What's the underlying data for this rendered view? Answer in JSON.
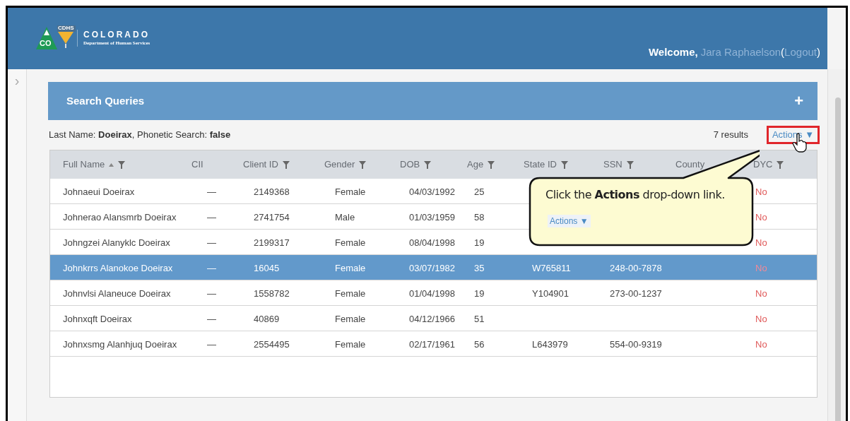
{
  "header": {
    "logo": {
      "state": "CO",
      "badge": "CDHS",
      "title": "COLORADO",
      "subtitle": "Department of Human Services"
    },
    "user_menu": {
      "greeting": "Welcome,",
      "user_name": "Jara Raphaelson",
      "open_paren": "(",
      "logout": "Logout",
      "close_paren": ")"
    }
  },
  "sidebar": {
    "toggle": "›"
  },
  "panel": {
    "title": "Search Queries",
    "add_button": "+"
  },
  "summary": "Last Name: **Doeirax**, Phonetic Search: **false**",
  "results_count": "7 results",
  "actions": {
    "label": "Actions",
    "caret": "▼"
  },
  "table": {
    "columns": [
      {
        "label": "Full Name",
        "sorted": true,
        "filter": true
      },
      {
        "label": "CII",
        "sorted": false,
        "filter": false
      },
      {
        "label": "Client ID",
        "sorted": false,
        "filter": true
      },
      {
        "label": "Gender",
        "sorted": false,
        "filter": true
      },
      {
        "label": "DOB",
        "sorted": false,
        "filter": true
      },
      {
        "label": "Age",
        "sorted": false,
        "filter": true
      },
      {
        "label": "State ID",
        "sorted": false,
        "filter": true
      },
      {
        "label": "SSN",
        "sorted": false,
        "filter": true
      },
      {
        "label": "County",
        "sorted": false,
        "filter": false
      },
      {
        "label": "DYC",
        "sorted": false,
        "filter": true
      }
    ],
    "rows": [
      {
        "selected": false,
        "cells": [
          "Johnaeui Doeirax",
          "—",
          "2149368",
          "Female",
          "04/03/1992",
          "25",
          null,
          null,
          null,
          "No"
        ]
      },
      {
        "selected": false,
        "cells": [
          "Johnerao Alansmrb Doeirax",
          "—",
          "2741754",
          "Male",
          "01/03/1959",
          "58",
          null,
          null,
          null,
          "No"
        ]
      },
      {
        "selected": false,
        "cells": [
          "Johngzei Alanyklc Doeirax",
          "—",
          "2199317",
          "Female",
          "08/04/1998",
          "19",
          null,
          null,
          null,
          "No"
        ]
      },
      {
        "selected": true,
        "cells": [
          "Johnkrrs Alanokoe Doeirax",
          "—",
          "16045",
          "Female",
          "03/07/1982",
          "35",
          "W765811",
          "248-00-7878",
          null,
          "No"
        ]
      },
      {
        "selected": false,
        "cells": [
          "Johnvlsi Alaneuce Doeirax",
          "—",
          "1558782",
          "Female",
          "01/04/1998",
          "19",
          "Y104901",
          "273-00-1237",
          null,
          "No"
        ]
      },
      {
        "selected": false,
        "cells": [
          "Johnxqft Doeirax",
          "—",
          "40869",
          "Female",
          "04/12/1966",
          "51",
          null,
          null,
          null,
          "No"
        ]
      },
      {
        "selected": false,
        "cells": [
          "Johnxsmg Alanhjuq Doeirax",
          "—",
          "2554495",
          "Female",
          "02/17/1961",
          "56",
          "L643979",
          "554-00-9319",
          null,
          "No"
        ]
      }
    ]
  },
  "callout": {
    "text": "Click the **Actions** drop-down link.",
    "sample_link": {
      "label": "Actions",
      "caret": "▼"
    }
  }
}
